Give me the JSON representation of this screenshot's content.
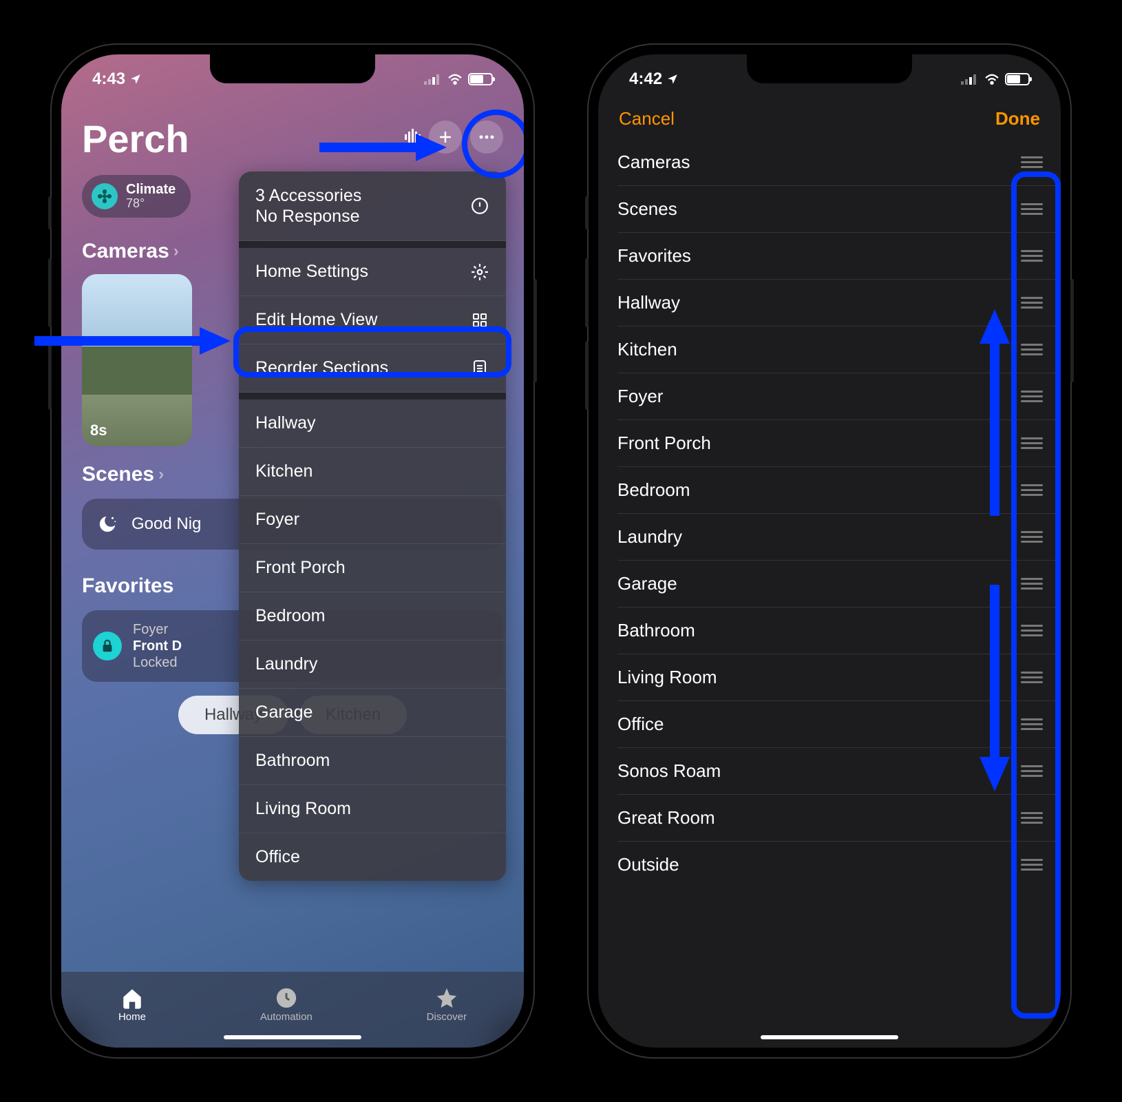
{
  "left": {
    "status": {
      "time": "4:43"
    },
    "home": {
      "title": "Perch",
      "climate": {
        "label": "Climate",
        "temp": "78°"
      },
      "sections": {
        "cameras": "Cameras",
        "scenes": "Scenes",
        "favorites": "Favorites"
      },
      "camera_time": "8s",
      "scene_name": "Good Nig",
      "favorite": {
        "room": "Foyer",
        "name": "Front D",
        "state": "Locked"
      },
      "room_pills": [
        "Hallway",
        "Kitchen"
      ]
    },
    "menu": {
      "status_line1": "3 Accessories",
      "status_line2": "No Response",
      "home_settings": "Home Settings",
      "edit_home_view": "Edit Home View",
      "reorder_sections": "Reorder Sections",
      "rooms": [
        "Hallway",
        "Kitchen",
        "Foyer",
        "Front Porch",
        "Bedroom",
        "Laundry",
        "Garage",
        "Bathroom",
        "Living Room",
        "Office"
      ]
    },
    "tabs": {
      "home": "Home",
      "automation": "Automation",
      "discover": "Discover"
    }
  },
  "right": {
    "status": {
      "time": "4:42"
    },
    "nav": {
      "cancel": "Cancel",
      "done": "Done"
    },
    "rows": [
      "Cameras",
      "Scenes",
      "Favorites",
      "Hallway",
      "Kitchen",
      "Foyer",
      "Front Porch",
      "Bedroom",
      "Laundry",
      "Garage",
      "Bathroom",
      "Living Room",
      "Office",
      "Sonos Roam",
      "Great Room",
      "Outside"
    ]
  }
}
